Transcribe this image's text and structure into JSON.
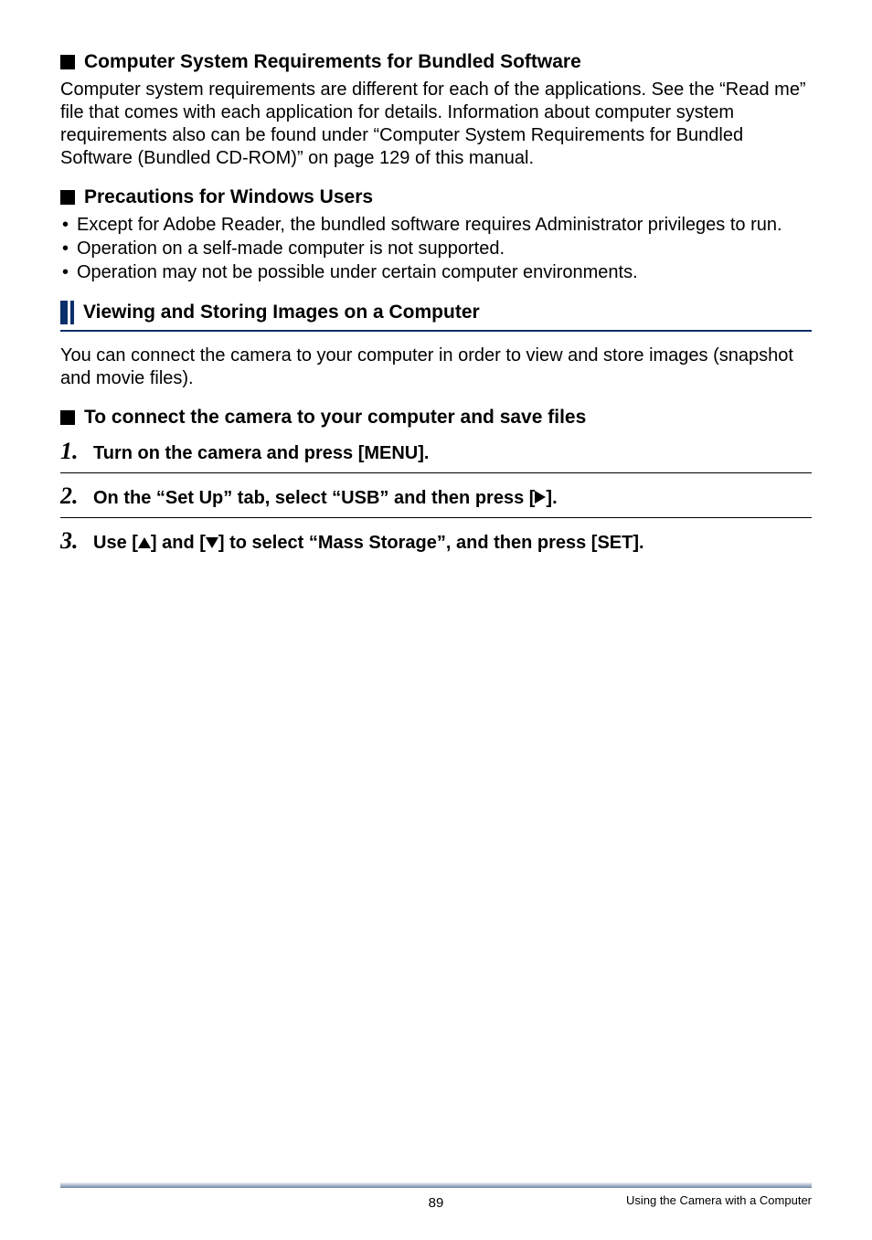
{
  "h1": {
    "title": "Computer System Requirements for Bundled Software",
    "body": "Computer system requirements are different for each of the applications. See the “Read me” file that comes with each application for details. Information about computer system requirements also can be found under “Computer System Requirements for Bundled Software (Bundled CD-ROM)” on page 129 of this manual."
  },
  "h2": {
    "title": "Precautions for Windows Users",
    "bullets": [
      "Except for Adobe Reader, the bundled software requires Administrator privileges to run.",
      "Operation on a self-made computer is not supported.",
      "Operation may not be possible under certain computer environments."
    ]
  },
  "section": {
    "title": "Viewing and Storing Images on a Computer",
    "intro": "You can connect the camera to your computer in order to view and store images (snapshot and movie files)."
  },
  "h3": {
    "title": "To connect the camera to your computer and save files"
  },
  "steps": {
    "s1": {
      "num": "1.",
      "text": "Turn on the camera and press [MENU]."
    },
    "s2": {
      "num": "2.",
      "pre": "On the “Set Up” tab, select “USB” and then press [",
      "post": "]."
    },
    "s3": {
      "num": "3.",
      "a": "Use [",
      "b": "] and [",
      "c": "] to select “Mass Storage”, and then press [SET]."
    }
  },
  "footer": {
    "page": "89",
    "section": "Using the Camera with a Computer"
  }
}
